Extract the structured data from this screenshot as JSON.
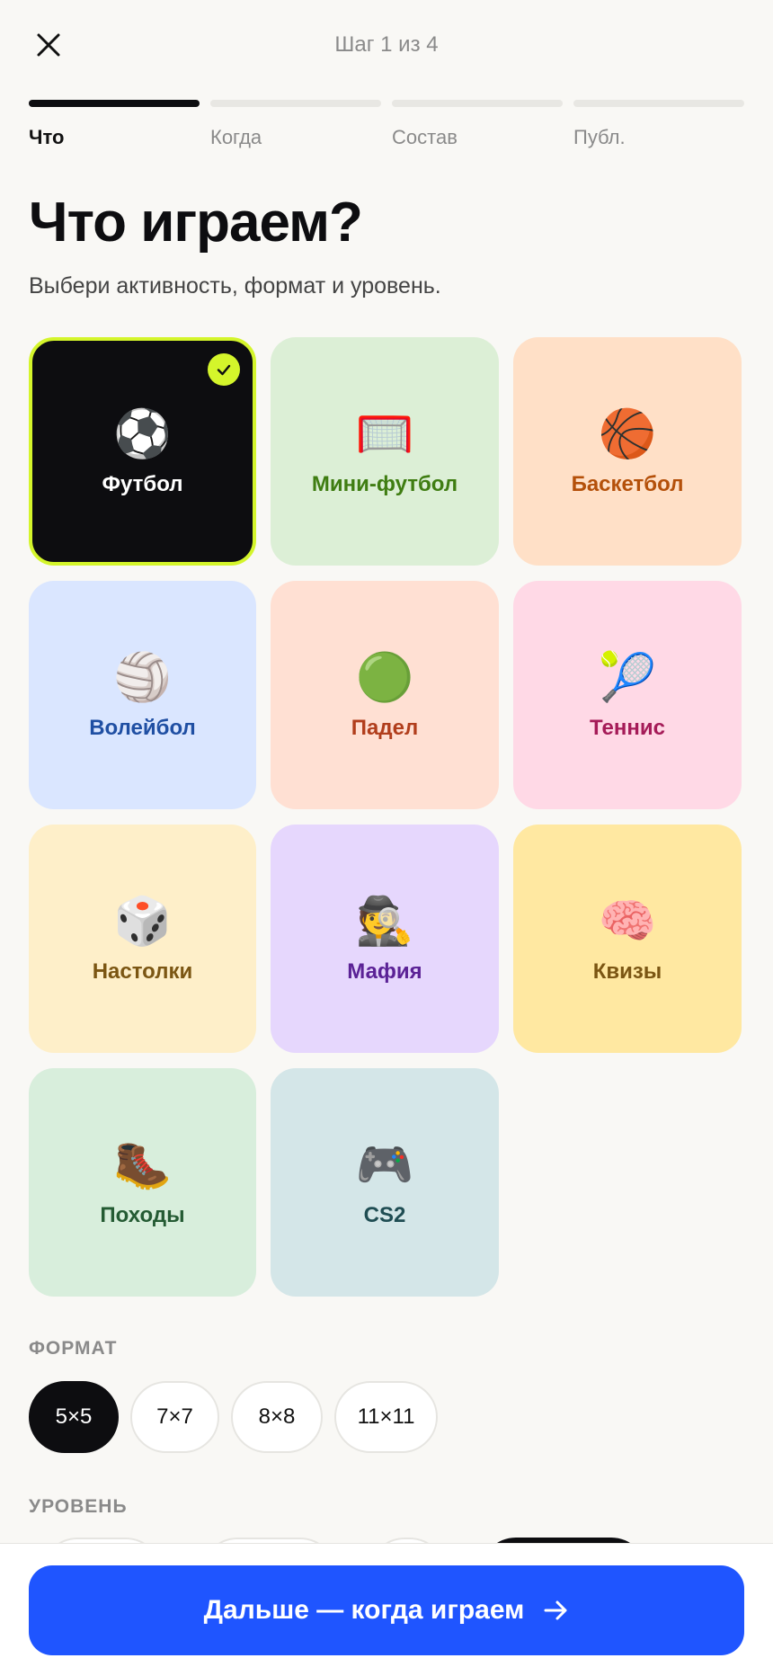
{
  "header": {
    "step_label": "Шаг 1 из 4",
    "close_icon": "close-icon"
  },
  "steps": [
    {
      "label": "Что",
      "active": true
    },
    {
      "label": "Когда",
      "active": false
    },
    {
      "label": "Состав",
      "active": false
    },
    {
      "label": "Публ.",
      "active": false
    }
  ],
  "main": {
    "title": "Что играем?",
    "subtitle": "Выбери активность, формат и уровень."
  },
  "activities": [
    {
      "label": "Футбол",
      "emoji": "⚽",
      "bg": "#0d0d10",
      "color": "#ffffff",
      "selected": true
    },
    {
      "label": "Мини-футбол",
      "emoji": "🥅",
      "bg": "#dcefd6",
      "color": "#3f7d12",
      "selected": false
    },
    {
      "label": "Баскетбол",
      "emoji": "🏀",
      "bg": "#ffe0c7",
      "color": "#b4500a",
      "selected": false
    },
    {
      "label": "Волейбол",
      "emoji": "🏐",
      "bg": "#dae6ff",
      "color": "#1f4fa3",
      "selected": false
    },
    {
      "label": "Падел",
      "emoji": "🟢",
      "bg": "#ffe0d3",
      "color": "#b13e1c",
      "selected": false
    },
    {
      "label": "Теннис",
      "emoji": "🎾",
      "bg": "#ffd9e6",
      "color": "#a51b58",
      "selected": false
    },
    {
      "label": "Настолки",
      "emoji": "🎲",
      "bg": "#feefc9",
      "color": "#7b5613",
      "selected": false
    },
    {
      "label": "Мафия",
      "emoji": "🕵",
      "bg": "#e6d7fd",
      "color": "#5b2296",
      "selected": false
    },
    {
      "label": "Квизы",
      "emoji": "🧠",
      "bg": "#ffe8a1",
      "color": "#7b5613",
      "selected": false
    },
    {
      "label": "Походы",
      "emoji": "🥾",
      "bg": "#d8eedc",
      "color": "#245b33",
      "selected": false
    },
    {
      "label": "CS2",
      "emoji": "🎮",
      "bg": "#d4e6e8",
      "color": "#1f4d53",
      "selected": false
    }
  ],
  "format": {
    "label": "ФОРМАТ",
    "options": [
      "5×5",
      "7×7",
      "8×8",
      "11×11"
    ],
    "selected": "5×5"
  },
  "level": {
    "label": "УРОВЕНЬ"
  },
  "cta": {
    "label": "Дальше — когда играем",
    "arrow_icon": "arrow-right-icon"
  },
  "colors": {
    "accent": "#d4f52b",
    "cta": "#1f55ff",
    "dark": "#0d0d10"
  }
}
